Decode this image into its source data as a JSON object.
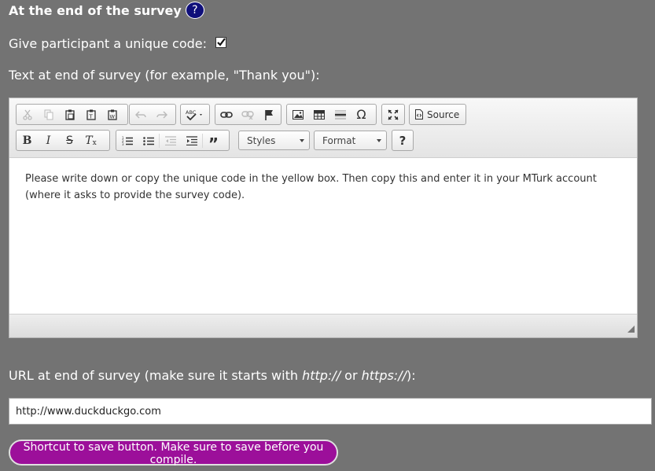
{
  "section": {
    "title": "At the end of the survey",
    "help_badge": "?"
  },
  "unique_code": {
    "label": "Give participant a unique code:",
    "checked": true
  },
  "end_text": {
    "label": "Text at end of survey (for example, \"Thank you\"):",
    "content": "Please write down or copy the unique code in the yellow box. Then copy this and enter it in your MTurk account (where it asks to provide the survey code)."
  },
  "toolbar": {
    "row1": [
      {
        "name": "cut-icon",
        "glyph": "✂",
        "enabled": false
      },
      {
        "name": "copy-icon",
        "glyph": "⎘",
        "enabled": false
      },
      {
        "name": "paste-icon",
        "glyph": "📋",
        "enabled": true
      },
      {
        "name": "paste-text-icon",
        "glyph": "📋",
        "enabled": true
      },
      {
        "name": "paste-word-icon",
        "glyph": "📋",
        "enabled": true
      },
      {
        "name": "undo-icon",
        "glyph": "↶",
        "enabled": false
      },
      {
        "name": "redo-icon",
        "glyph": "↷",
        "enabled": false
      },
      {
        "name": "spellcheck-icon",
        "glyph": "ABC✓",
        "enabled": true
      },
      {
        "name": "link-icon",
        "glyph": "🔗",
        "enabled": true
      },
      {
        "name": "unlink-icon",
        "glyph": "⛓",
        "enabled": false
      },
      {
        "name": "anchor-icon",
        "glyph": "⚑",
        "enabled": true
      },
      {
        "name": "image-icon",
        "glyph": "🖼",
        "enabled": true
      },
      {
        "name": "table-icon",
        "glyph": "▦",
        "enabled": true
      },
      {
        "name": "horizontal-rule-icon",
        "glyph": "☰",
        "enabled": true
      },
      {
        "name": "special-char-icon",
        "glyph": "Ω",
        "enabled": true
      },
      {
        "name": "maximize-icon",
        "glyph": "⤢",
        "enabled": true
      }
    ],
    "source_label": "Source",
    "row2": [
      {
        "name": "bold-icon",
        "glyph": "B",
        "enabled": true
      },
      {
        "name": "italic-icon",
        "glyph": "I",
        "enabled": true
      },
      {
        "name": "strike-icon",
        "glyph": "S",
        "enabled": true
      },
      {
        "name": "remove-format-icon",
        "glyph": "Tx",
        "enabled": true
      },
      {
        "name": "numbered-list-icon",
        "glyph": "≡",
        "enabled": true
      },
      {
        "name": "bulleted-list-icon",
        "glyph": "≡",
        "enabled": true
      },
      {
        "name": "outdent-icon",
        "glyph": "⇤",
        "enabled": false
      },
      {
        "name": "indent-icon",
        "glyph": "⇥",
        "enabled": true
      },
      {
        "name": "blockquote-icon",
        "glyph": "❞",
        "enabled": true
      }
    ],
    "styles_label": "Styles",
    "format_label": "Format",
    "help_glyph": "?"
  },
  "url": {
    "label_pre": "URL at end of survey (make sure it starts with ",
    "label_http": "http://",
    "label_or": " or ",
    "label_https": "https://",
    "label_post": "):",
    "value": "http://www.duckduckgo.com"
  },
  "save_button": {
    "label": "Shortcut to save button. Make sure to save before you compile."
  },
  "colors": {
    "background": "#737373",
    "save_button": "#9c0f9a",
    "help_badge": "#10107a"
  }
}
